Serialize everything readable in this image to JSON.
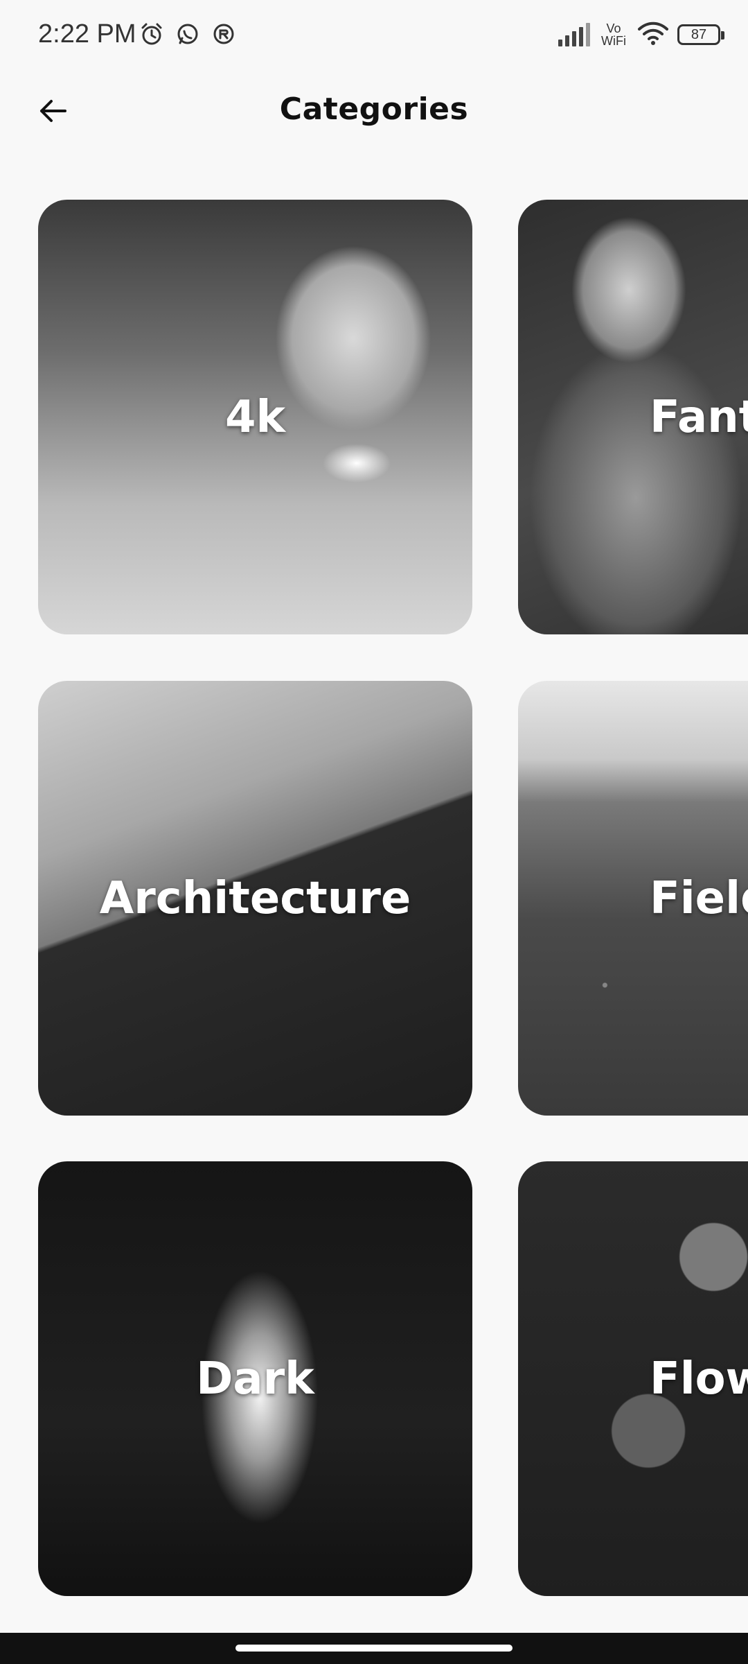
{
  "status_bar": {
    "time": "2:22 PM",
    "left_icons": [
      "alarm-icon",
      "whatsapp-icon",
      "app-notification-icon"
    ],
    "vowifi_top": "Vo",
    "vowifi_bottom": "WiFi",
    "battery": "87"
  },
  "header": {
    "title": "Categories",
    "back_icon": "arrow-left-icon"
  },
  "categories": [
    {
      "label": "4k"
    },
    {
      "label": "Fantasy"
    },
    {
      "label": "Architecture"
    },
    {
      "label": "Fields"
    },
    {
      "label": "Dark"
    },
    {
      "label": "Flowers"
    }
  ]
}
